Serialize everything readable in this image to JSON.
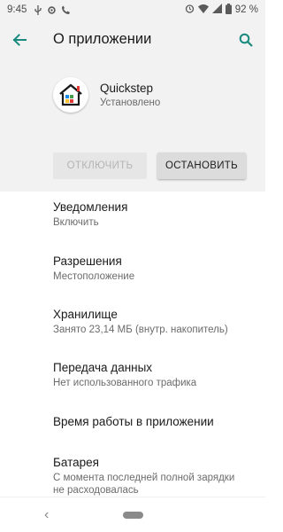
{
  "status_bar": {
    "time": "9:45",
    "battery": "92 %",
    "icons": [
      "usb-icon",
      "settings-icon",
      "wifi-calling-icon",
      "alarm-icon",
      "wifi-icon",
      "signal-icon",
      "battery-icon"
    ]
  },
  "app_bar": {
    "title": "О приложении",
    "back_icon": "arrow-back-icon",
    "search_icon": "search-icon"
  },
  "app": {
    "name": "Quickstep",
    "status": "Установлено",
    "icon": "home-launcher-icon"
  },
  "buttons": {
    "disable": "ОТКЛЮЧИТЬ",
    "stop": "ОСТАНОВИТЬ"
  },
  "items": [
    {
      "title": "Уведомления",
      "subtitle": "Включить"
    },
    {
      "title": "Разрешения",
      "subtitle": "Местоположение"
    },
    {
      "title": "Хранилище",
      "subtitle": "Занято 23,14 МБ (внутр. накопитель)"
    },
    {
      "title": "Передача данных",
      "subtitle": "Нет использованного трафика"
    },
    {
      "title": "Время работы в приложении",
      "subtitle": ""
    },
    {
      "title": "Батарея",
      "subtitle": "С момента последней полной зарядки не расходовалась"
    }
  ],
  "nav": {
    "back": "‹"
  },
  "colors": {
    "accent": "#1a8a7e",
    "header_bg": "#f2f2f2"
  }
}
